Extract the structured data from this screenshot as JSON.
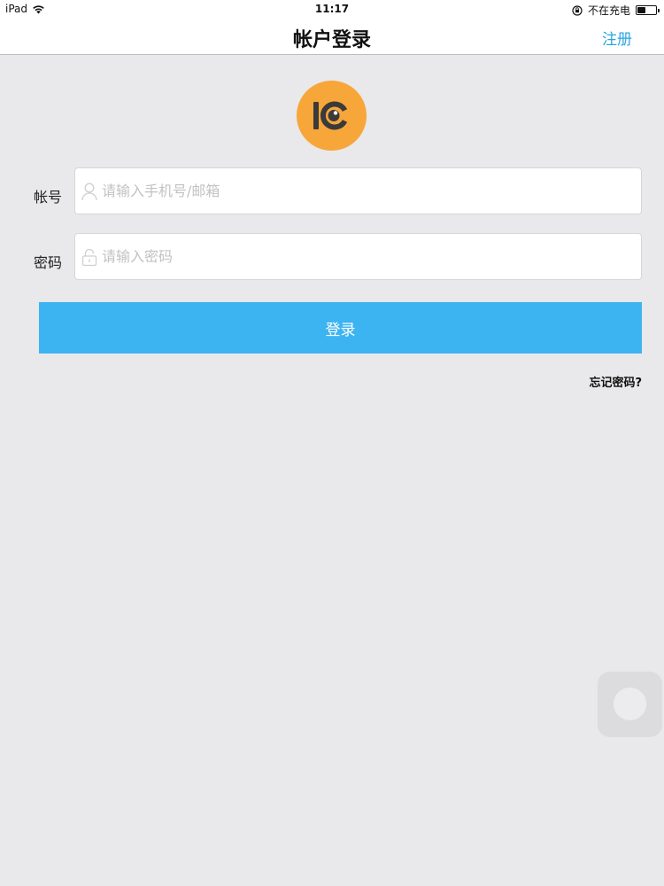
{
  "status_bar": {
    "device": "iPad",
    "time": "11:17",
    "charging_status": "不在充电",
    "battery_level": 0.45
  },
  "nav": {
    "title": "帐户登录",
    "register_label": "注册"
  },
  "form": {
    "account_label": "帐号",
    "account_placeholder": "请输入手机号/邮箱",
    "password_label": "密码",
    "password_placeholder": "请输入密码",
    "login_label": "登录",
    "forgot_label": "忘记密码?"
  },
  "colors": {
    "accent": "#3db4f2",
    "link": "#2aa6e0",
    "logo_bg": "#f7a63a",
    "background": "#e9e8ea"
  }
}
